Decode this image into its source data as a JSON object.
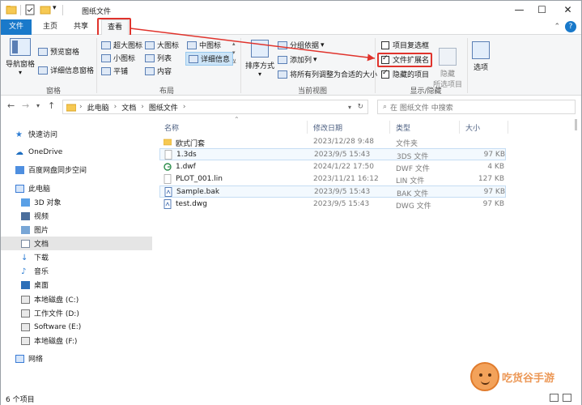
{
  "window": {
    "title": "图纸文件",
    "minimize": "—",
    "maximize": "☐",
    "close": "✕"
  },
  "ribbon_tabs": {
    "file": "文件",
    "home": "主页",
    "share": "共享",
    "view": "查看",
    "help": "?"
  },
  "ribbon": {
    "panes": {
      "nav_pane": "导航窗格",
      "preview_pane": "预览窗格",
      "details_pane": "详细信息窗格",
      "group": "窗格"
    },
    "layout": {
      "xlarge_icons": "超大图标",
      "large_icons": "大图标",
      "medium_icons": "中图标",
      "small_icons": "小图标",
      "list": "列表",
      "details": "详细信息",
      "tiles": "平铺",
      "content": "内容",
      "group": "布局"
    },
    "current_view": {
      "sort_by": "排序方式",
      "group_by": "分组依据",
      "add_columns": "添加列",
      "size_all_columns": "将所有列调整为合适的大小",
      "group": "当前视图"
    },
    "show_hide": {
      "item_checkboxes": "项目复选框",
      "file_extensions": "文件扩展名",
      "hidden_items": "隐藏的项目",
      "hide_selected": "隐藏",
      "hide_selected_sub": "所选项目",
      "options": "选项",
      "group": "显示/隐藏",
      "item_checkboxes_checked": false,
      "file_extensions_checked": true,
      "hidden_items_checked": true
    }
  },
  "address": {
    "path": [
      "此电脑",
      "文档",
      "图纸文件"
    ],
    "search_placeholder": "在 图纸文件 中搜索"
  },
  "nav": {
    "items": [
      {
        "label": "快速访问"
      },
      {
        "label": "OneDrive"
      },
      {
        "label": "百度网盘同步空间"
      },
      {
        "label": "此电脑"
      },
      {
        "label": "3D 对象"
      },
      {
        "label": "视频"
      },
      {
        "label": "图片"
      },
      {
        "label": "文档"
      },
      {
        "label": "下载"
      },
      {
        "label": "音乐"
      },
      {
        "label": "桌面"
      },
      {
        "label": "本地磁盘 (C:)"
      },
      {
        "label": "工作文件 (D:)"
      },
      {
        "label": "Software (E:)"
      },
      {
        "label": "本地磁盘 (F:)"
      },
      {
        "label": "网络"
      }
    ]
  },
  "columns": {
    "name": "名称",
    "date": "修改日期",
    "type": "类型",
    "size": "大小"
  },
  "files": [
    {
      "name": "欧式门套",
      "date": "2023/12/28 9:48",
      "type": "文件夹",
      "size": ""
    },
    {
      "name": "1.3ds",
      "date": "2023/9/5 15:43",
      "type": "3DS 文件",
      "size": "97 KB"
    },
    {
      "name": "1.dwf",
      "date": "2024/1/22 17:50",
      "type": "DWF 文件",
      "size": "4 KB"
    },
    {
      "name": "PLOT_001.lin",
      "date": "2023/11/21 16:12",
      "type": "LIN 文件",
      "size": "127 KB"
    },
    {
      "name": "Sample.bak",
      "date": "2023/9/5 15:43",
      "type": "BAK 文件",
      "size": "97 KB"
    },
    {
      "name": "test.dwg",
      "date": "2023/9/5 15:43",
      "type": "DWG 文件",
      "size": "97 KB"
    }
  ],
  "status": {
    "count": "6 个项目"
  },
  "watermark": {
    "text": "吃货谷手游"
  }
}
